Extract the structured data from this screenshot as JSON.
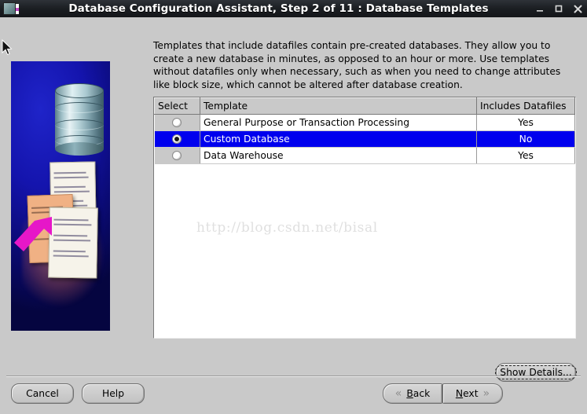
{
  "window": {
    "title": "Database Configuration Assistant, Step 2 of 11 : Database Templates",
    "app_icon": "database-app-icon",
    "minimize_label": "_",
    "maximize_label": "□",
    "close_label": "✕"
  },
  "main": {
    "description": "Templates that include datafiles contain pre-created databases. They allow you to create a new database in minutes, as opposed to an hour or more. Use templates without datafiles only when necessary, such as when you need to change attributes like block size, which cannot be altered after database creation.",
    "watermark": "http://blog.csdn.net/bisal"
  },
  "table": {
    "columns": [
      "Select",
      "Template",
      "Includes Datafiles"
    ],
    "rows": [
      {
        "selected": false,
        "template": "General Purpose or Transaction Processing",
        "includes_datafiles": "Yes"
      },
      {
        "selected": true,
        "template": "Custom Database",
        "includes_datafiles": "No"
      },
      {
        "selected": false,
        "template": "Data Warehouse",
        "includes_datafiles": "Yes"
      }
    ]
  },
  "actions": {
    "show_details": "Show Details...",
    "cancel": "Cancel",
    "help": "Help",
    "back": "Back",
    "next": "Next",
    "back_chevron": "«",
    "next_chevron": "»"
  },
  "colors": {
    "selection_blue": "#0000ee",
    "panel_gray": "#c9c9c9",
    "titlebar_dark": "#1b1e22",
    "graphic_blue": "#1414ad",
    "arrow_magenta": "#e617c8"
  }
}
